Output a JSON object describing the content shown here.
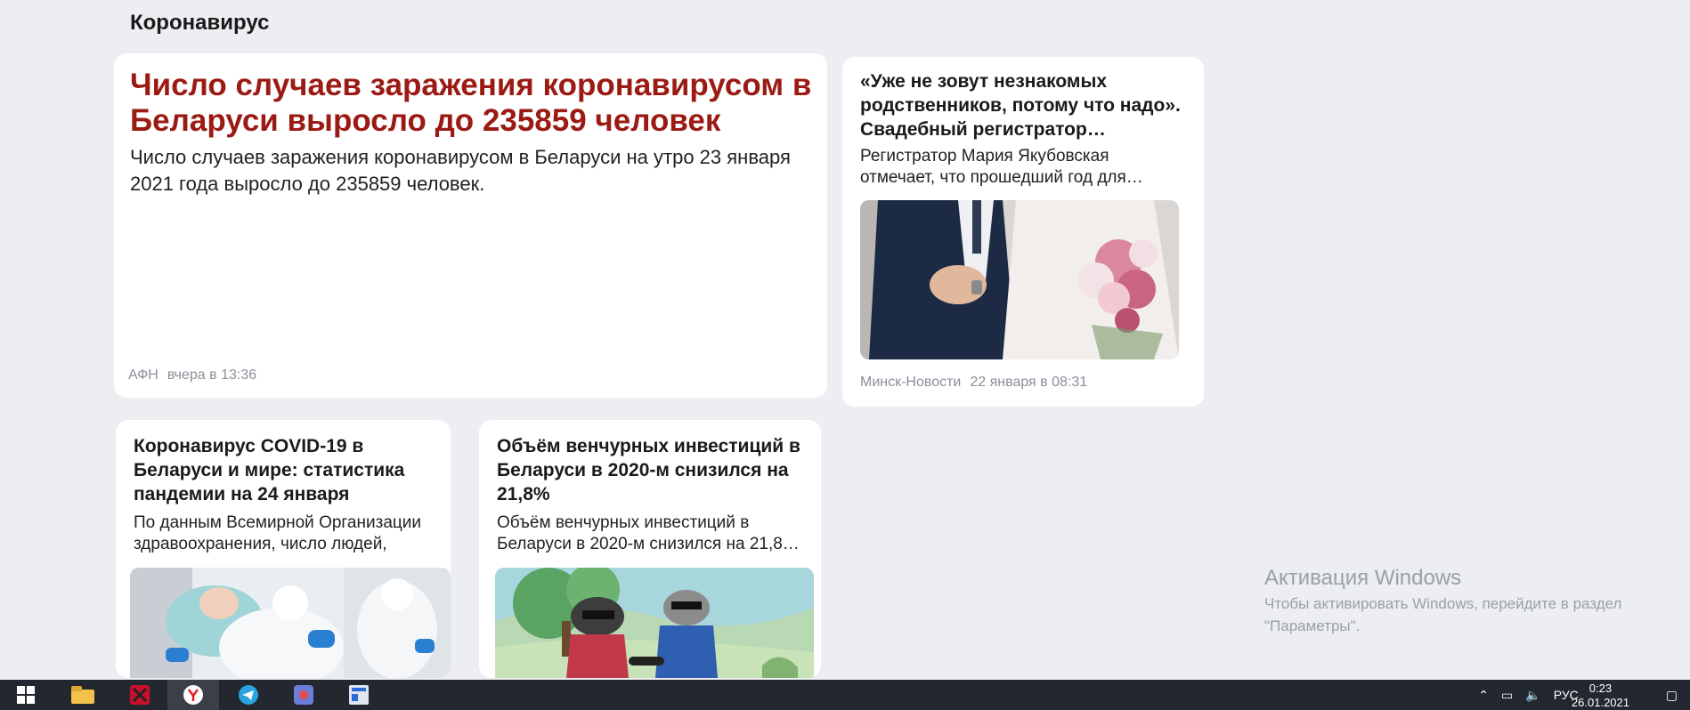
{
  "section": {
    "title": "Коронавирус"
  },
  "main_article": {
    "title": "Число случаев заражения коронавирусом в Беларуси выросло до 235859 человек",
    "snippet": "Число случаев заражения коронавирусом в Беларуси на утро 23 января 2021 года выросло до 235859 человек.",
    "source": "АФН",
    "time": "вчера в 13:36"
  },
  "right_article": {
    "title": "«Уже не зовут незнакомых родственников, потому что надо». Свадебный регистратор…",
    "snippet": "Регистратор Мария Якубовская отмечает, что прошедший год для…",
    "source": "Минск-Новости",
    "time": "22 января в 08:31",
    "image": "wedding-photo"
  },
  "small_articles": [
    {
      "title": "Коронавирус COVID-19 в Беларуси и мире: статистика пандемии на 24 января",
      "snippet": "По данным Всемирной Организации здравоохранения, число людей,",
      "image": "medical-staff-photo"
    },
    {
      "title": "Объём венчурных инвестиций в Беларуси в 2020-м снизился на 21,8%",
      "snippet": "Объём венчурных инвестиций в Беларуси в 2020-м снизился на 21,8…",
      "image": "raccoons-illustration"
    }
  ],
  "watermark": {
    "title": "Активация Windows",
    "text": "Чтобы активировать Windows, перейдите в раздел \"Параметры\"."
  },
  "taskbar": {
    "apps": [
      "start-icon",
      "explorer-icon",
      "app-icon",
      "yandex-browser-icon",
      "telegram-icon",
      "app2-icon",
      "app3-icon"
    ],
    "language": "РУС",
    "time": "0:23",
    "date": "26.01.2021"
  },
  "colors": {
    "headline": "#9b1b14",
    "background": "#eceef2",
    "taskbar": "#23272f"
  }
}
